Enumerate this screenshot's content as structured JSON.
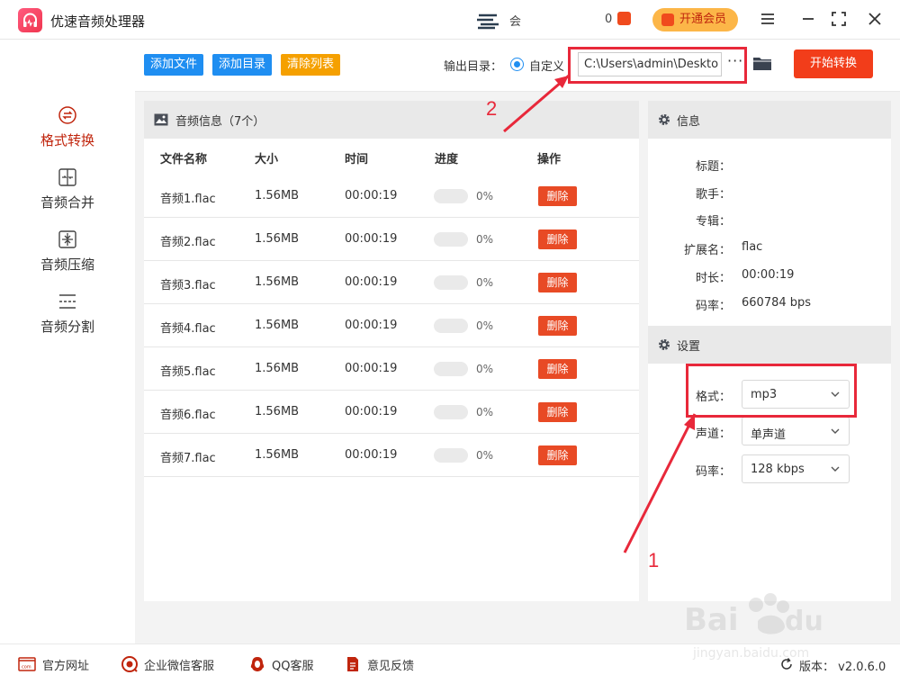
{
  "app": {
    "title": "优速音频处理器",
    "user_text": "会",
    "count_text": "0",
    "vip_label": "开通会员",
    "colors": {
      "accent": "#f23d1a",
      "blue": "#1f8ef1",
      "orange": "#f5a000",
      "vip": "#fcb648",
      "red_text": "#c0250d"
    }
  },
  "toolbar": {
    "add_file": "添加文件",
    "add_dir": "添加目录",
    "clear_list": "清除列表",
    "output_label": "输出目录：",
    "custom_label": "自定义",
    "path_value": "C:\\Users\\admin\\Deskto",
    "more": "···",
    "start": "开始转换"
  },
  "sidebar": {
    "items": [
      {
        "label": "格式转换",
        "icon": "format-convert-icon",
        "active": true
      },
      {
        "label": "音频合并",
        "icon": "merge-icon",
        "active": false
      },
      {
        "label": "音频压缩",
        "icon": "compress-icon",
        "active": false
      },
      {
        "label": "音频分割",
        "icon": "split-icon",
        "active": false
      }
    ]
  },
  "list": {
    "title": "音频信息（7个）",
    "headers": {
      "name": "文件名称",
      "size": "大小",
      "time": "时间",
      "progress": "进度",
      "action": "操作"
    },
    "rows": [
      {
        "name": "音频1.flac",
        "size": "1.56MB",
        "time": "00:00:19",
        "progress": "0%",
        "action": "删除"
      },
      {
        "name": "音频2.flac",
        "size": "1.56MB",
        "time": "00:00:19",
        "progress": "0%",
        "action": "删除"
      },
      {
        "name": "音频3.flac",
        "size": "1.56MB",
        "time": "00:00:19",
        "progress": "0%",
        "action": "删除"
      },
      {
        "name": "音频4.flac",
        "size": "1.56MB",
        "time": "00:00:19",
        "progress": "0%",
        "action": "删除"
      },
      {
        "name": "音频5.flac",
        "size": "1.56MB",
        "time": "00:00:19",
        "progress": "0%",
        "action": "删除"
      },
      {
        "name": "音频6.flac",
        "size": "1.56MB",
        "time": "00:00:19",
        "progress": "0%",
        "action": "删除"
      },
      {
        "name": "音频7.flac",
        "size": "1.56MB",
        "time": "00:00:19",
        "progress": "0%",
        "action": "删除"
      }
    ]
  },
  "info": {
    "title": "信息",
    "fields": [
      {
        "key": "标题：",
        "value": ""
      },
      {
        "key": "歌手：",
        "value": ""
      },
      {
        "key": "专辑：",
        "value": ""
      },
      {
        "key": "扩展名：",
        "value": "flac"
      },
      {
        "key": "时长：",
        "value": "00:00:19"
      },
      {
        "key": "码率：",
        "value": "660784 bps"
      }
    ]
  },
  "settings": {
    "title": "设置",
    "format_label": "格式：",
    "format_value": "mp3",
    "channel_label": "声道：",
    "channel_value": "单声道",
    "bitrate_label": "码率：",
    "bitrate_value": "128 kbps"
  },
  "footer": {
    "website": "官方网址",
    "wechat": "企业微信客服",
    "qq": "QQ客服",
    "feedback": "意见反馈",
    "version": "版本：  v2.0.6.0"
  },
  "annotations": {
    "label1": "1",
    "label2": "2"
  }
}
